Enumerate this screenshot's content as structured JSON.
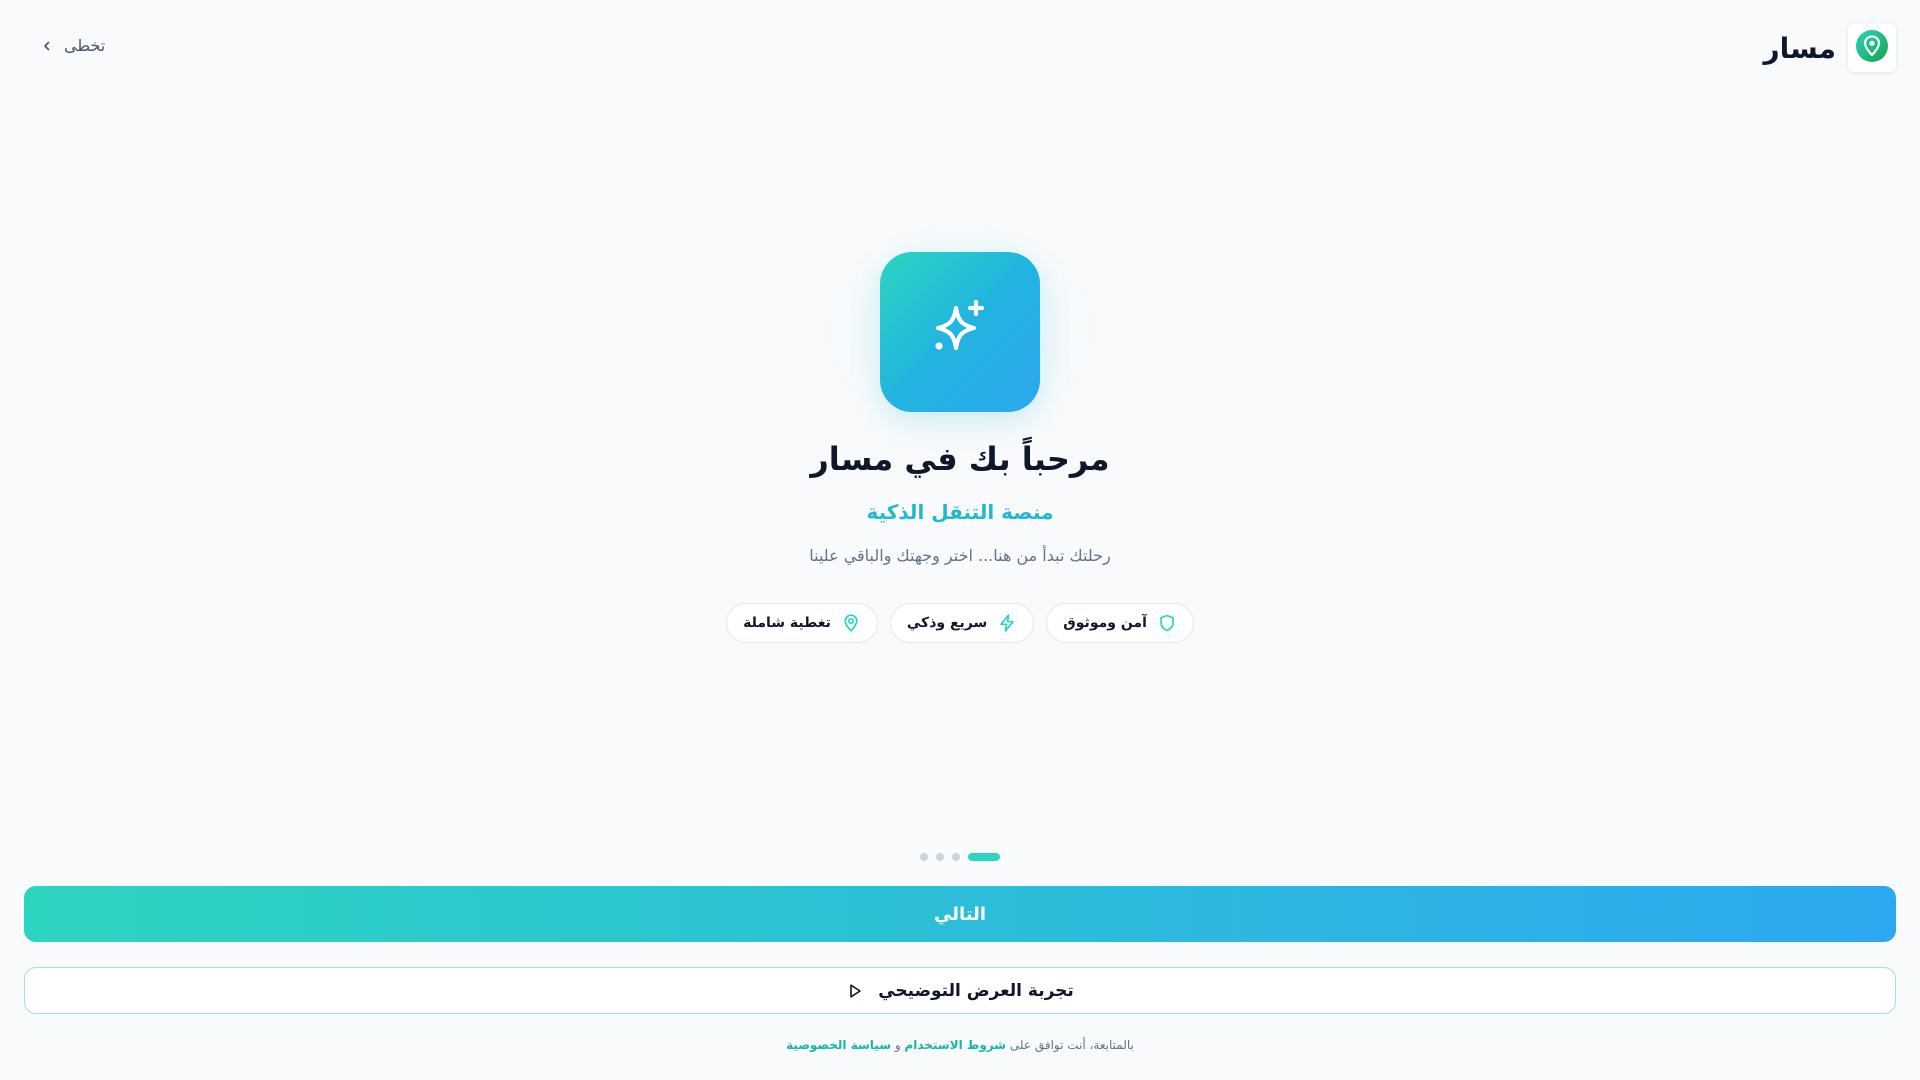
{
  "header": {
    "app_name": "مسار",
    "logo_icon": "map-pin-icon",
    "skip_label": "تخطى",
    "skip_icon": "chevron-left-icon"
  },
  "hero": {
    "icon": "sparkles-icon",
    "title": "مرحباً بك في مسار",
    "subtitle": "منصة التنقل الذكية",
    "description": "رحلتك تبدأ من هنا... اختر وجهتك والباقي علينا"
  },
  "features": [
    {
      "label": "آمن وموثوق",
      "icon": "shield-icon"
    },
    {
      "label": "سريع وذكي",
      "icon": "lightning-icon"
    },
    {
      "label": "تغطية شاملة",
      "icon": "map-pin-icon"
    }
  ],
  "pager": {
    "total": 4,
    "active_index": 0
  },
  "actions": {
    "next_label": "التالي",
    "demo_label": "تجربة العرض التوضيحي",
    "demo_icon": "play-icon"
  },
  "footer": {
    "prefix": "بالمتابعة، أنت توافق على",
    "terms_link": "شروط الاستخدام",
    "conjunction": "و",
    "privacy_link": "سياسة الخصوصية"
  },
  "colors": {
    "accent": "#2dd4bf",
    "accent_blue": "#2ba8f0",
    "background": "#f8fafc",
    "text": "#0f172a"
  }
}
